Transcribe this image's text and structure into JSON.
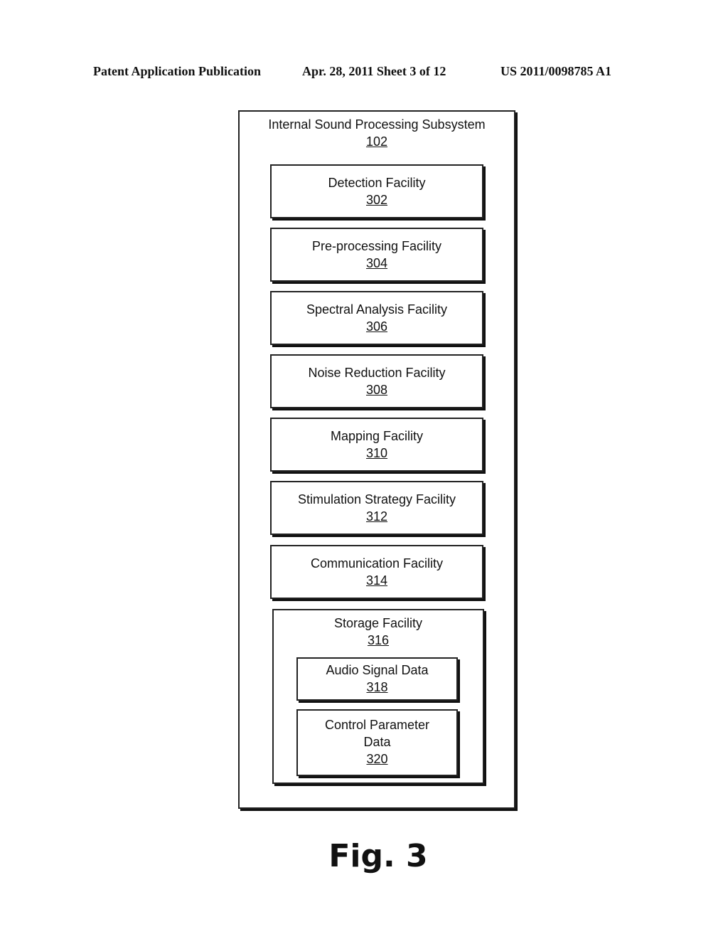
{
  "header": {
    "left": "Patent Application Publication",
    "middle": "Apr. 28, 2011  Sheet 3 of 12",
    "right": "US 2011/0098785 A1"
  },
  "diagram": {
    "outer": {
      "label": "Internal Sound Processing Subsystem",
      "ref": "102"
    },
    "facilities": [
      {
        "label": "Detection Facility",
        "ref": "302"
      },
      {
        "label": "Pre-processing Facility",
        "ref": "304"
      },
      {
        "label": "Spectral Analysis Facility",
        "ref": "306"
      },
      {
        "label": "Noise Reduction Facility",
        "ref": "308"
      },
      {
        "label": "Mapping Facility",
        "ref": "310"
      },
      {
        "label": "Stimulation Strategy Facility",
        "ref": "312"
      },
      {
        "label": "Communication Facility",
        "ref": "314"
      }
    ],
    "storage": {
      "label": "Storage Facility",
      "ref": "316",
      "items": [
        {
          "label": "Audio Signal Data",
          "ref": "318"
        },
        {
          "label_line1": "Control Parameter",
          "label_line2": "Data",
          "ref": "320"
        }
      ]
    }
  },
  "figure_label": "Fig. 3"
}
